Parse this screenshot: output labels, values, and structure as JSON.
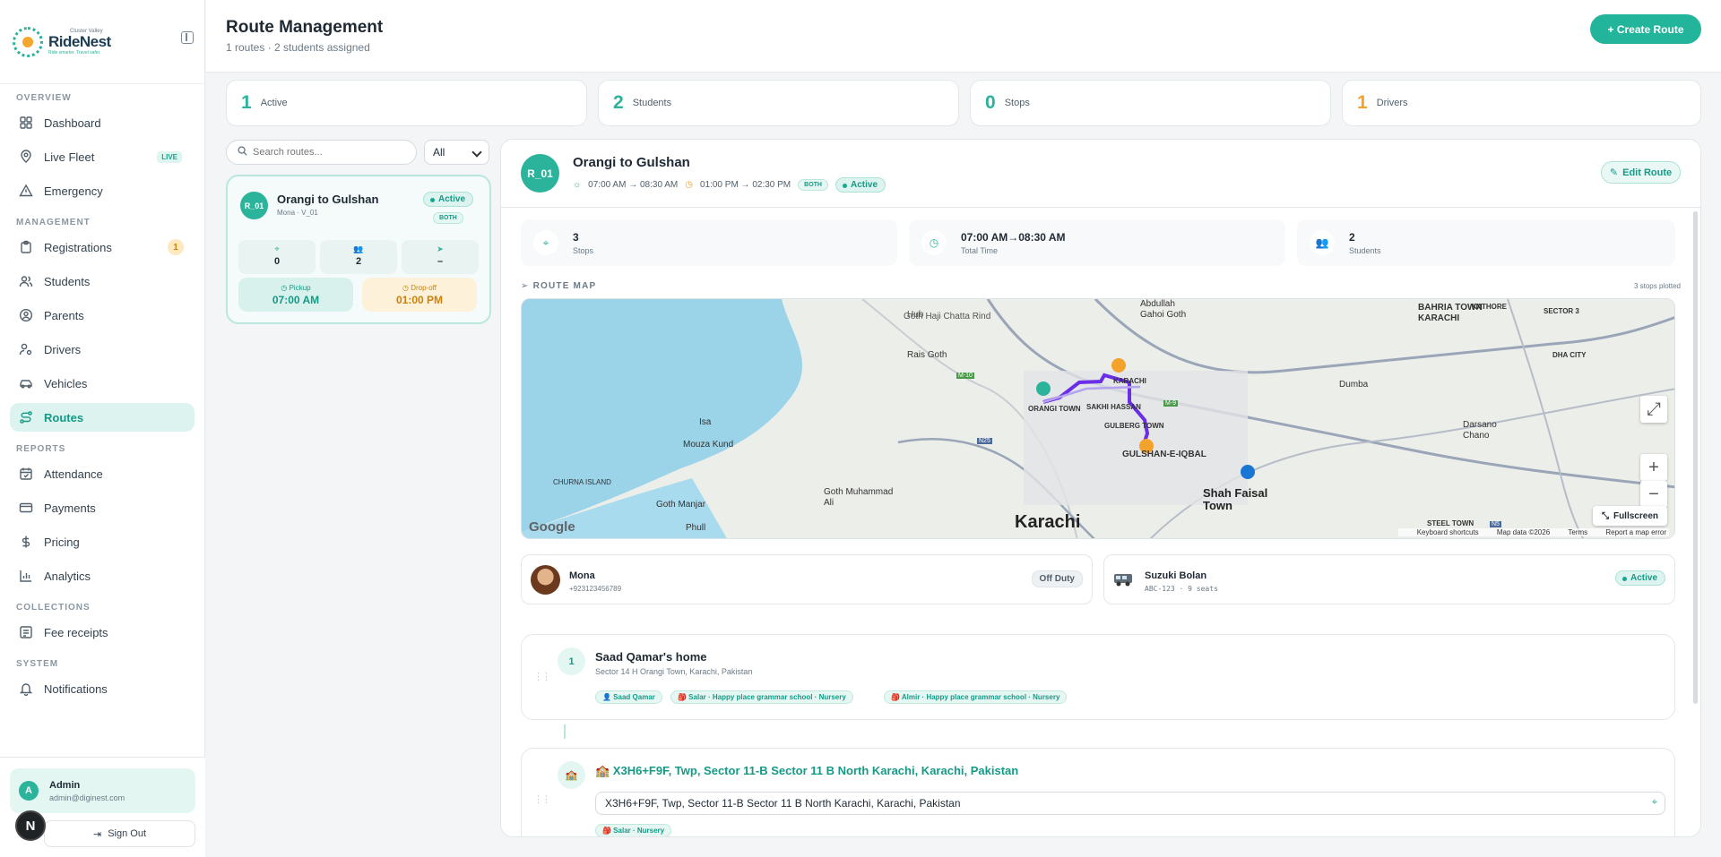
{
  "brand": {
    "top": "Cluster Valley",
    "name": "RideNest",
    "tagline": "Ride smarter. Travel safer."
  },
  "nav": {
    "sections": [
      {
        "label": "OVERVIEW",
        "items": [
          {
            "label": "Dashboard",
            "icon": "grid-icon"
          },
          {
            "label": "Live Fleet",
            "icon": "map-pin-icon",
            "badge": "LIVE"
          },
          {
            "label": "Emergency",
            "icon": "alert-triangle-icon"
          }
        ]
      },
      {
        "label": "MANAGEMENT",
        "items": [
          {
            "label": "Registrations",
            "icon": "clipboard-icon",
            "count": "1"
          },
          {
            "label": "Students",
            "icon": "users-icon"
          },
          {
            "label": "Parents",
            "icon": "user-circle-icon"
          },
          {
            "label": "Drivers",
            "icon": "user-key-icon"
          },
          {
            "label": "Vehicles",
            "icon": "car-icon"
          },
          {
            "label": "Routes",
            "icon": "route-icon",
            "active": true
          }
        ]
      },
      {
        "label": "REPORTS",
        "items": [
          {
            "label": "Attendance",
            "icon": "calendar-check-icon"
          },
          {
            "label": "Payments",
            "icon": "credit-card-icon"
          },
          {
            "label": "Pricing",
            "icon": "dollar-icon"
          },
          {
            "label": "Analytics",
            "icon": "bar-chart-icon"
          }
        ]
      },
      {
        "label": "COLLECTIONS",
        "items": [
          {
            "label": "Fee receipts",
            "icon": "receipt-icon"
          }
        ]
      },
      {
        "label": "SYSTEM",
        "items": [
          {
            "label": "Notifications",
            "icon": "bell-icon"
          }
        ]
      }
    ]
  },
  "user": {
    "initial": "A",
    "name": "Admin",
    "email": "admin@diginest.com",
    "signout": "Sign Out",
    "dev_badge": "N"
  },
  "header": {
    "title": "Route Management",
    "subtitle": "1 routes · 2 students assigned",
    "create_label": "+ Create Route"
  },
  "stats": [
    {
      "value": "1",
      "label": "Active",
      "color": "#2bb39b"
    },
    {
      "value": "2",
      "label": "Students",
      "color": "#2bb39b"
    },
    {
      "value": "0",
      "label": "Stops",
      "color": "#2bb39b"
    },
    {
      "value": "1",
      "label": "Drivers",
      "color": "#f3a32c"
    }
  ],
  "filters": {
    "search_placeholder": "Search routes...",
    "select_value": "All"
  },
  "route_card": {
    "code": "R_01",
    "name": "Orangi to Gulshan",
    "meta": "Mona · V_01",
    "status": "Active",
    "type": "BOTH",
    "mini": [
      {
        "value": "0"
      },
      {
        "value": "2"
      },
      {
        "value": "–"
      }
    ],
    "pickup_label": "Pickup",
    "pickup_time": "07:00 AM",
    "dropoff_label": "Drop-off",
    "dropoff_time": "01:00 PM"
  },
  "detail": {
    "code": "R_01",
    "name": "Orangi to Gulshan",
    "pickup_range": "07:00 AM → 08:30 AM",
    "dropoff_range": "01:00 PM → 02:30 PM",
    "type": "BOTH",
    "status": "Active",
    "edit_label": "Edit Route",
    "info": [
      {
        "value": "3",
        "label": "Stops"
      },
      {
        "value": "07:00 AM→08:30 AM",
        "label": "Total Time"
      },
      {
        "value": "2",
        "label": "Students"
      }
    ],
    "map_title": "ROUTE MAP",
    "map_plotted": "3 stops plotted",
    "map": {
      "labels": [
        "Goth Haji Chatta Rind",
        "Hub",
        "Rais Goth",
        "ORANGI TOWN",
        "SAKHI HASSAN",
        "GULBERG TOWN",
        "GULSHAN-E-IQBAL",
        "KARACHI",
        "Karachi",
        "Shah Faisal Town",
        "Isa",
        "Mouza Kund",
        "CHURNA ISLAND",
        "Goth Manjar",
        "Phull",
        "Goth Muhammad Ali",
        "BAHRIA TOWN KARACHI",
        "KATHORE",
        "SECTOR 3",
        "DHA CITY",
        "Dumba",
        "Darsano Chano",
        "Abdullah Gahoi Goth",
        "STEEL TOWN",
        "M-10",
        "M-9",
        "N25",
        "N5"
      ],
      "fullscreen": "Fullscreen",
      "google": "Google",
      "footer": [
        "Keyboard shortcuts",
        "Map data ©2026",
        "Terms",
        "Report a map error"
      ]
    },
    "driver": {
      "name": "Mona",
      "phone": "+923123456789",
      "status": "Off Duty"
    },
    "vehicle": {
      "name": "Suzuki Bolan",
      "plate": "ABC-123 · 9 seats",
      "status": "Active"
    },
    "stops": [
      {
        "num": "1",
        "title": "Saad Qamar's home",
        "address": "Sector 14 H Orangi Town, Karachi, Pakistan",
        "tags": [
          "👤 Saad Qamar",
          "🎒 Salar · Happy place grammar school · Nursery",
          "🎒 Almir · Happy place grammar school · Nursery"
        ]
      },
      {
        "title": "🏫 X3H6+F9F, Twp, Sector 11-B Sector 11 B North Karachi, Karachi, Pakistan",
        "input_value": "X3H6+F9F, Twp, Sector 11-B Sector 11 B North Karachi, Karachi, Pakistan",
        "tags": [
          "🎒 Salar · Nursery"
        ]
      }
    ]
  }
}
